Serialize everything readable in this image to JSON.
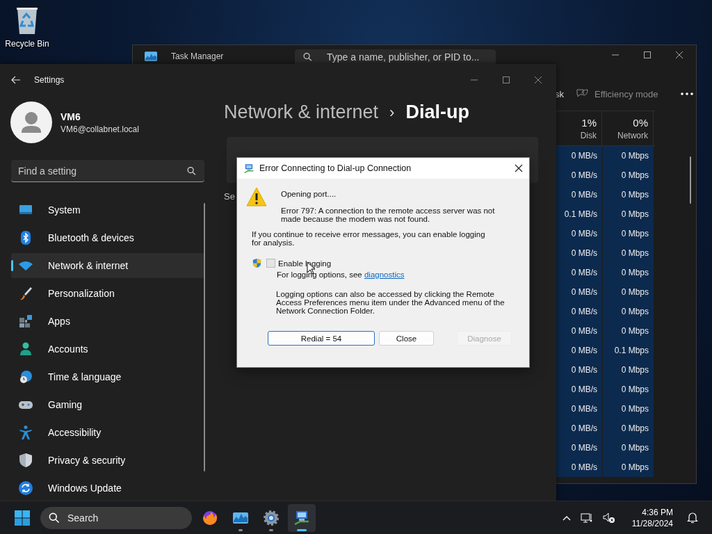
{
  "desktop_icons": [
    {
      "label": "Recycle Bin"
    }
  ],
  "task_manager": {
    "title": "Task Manager",
    "search": {
      "placeholder": "Type a name, publisher, or PID to..."
    },
    "toolbar": [
      {
        "label": "sk"
      },
      {
        "label": "Efficiency mode"
      }
    ],
    "columns": [
      {
        "percent": "1%",
        "label": "Disk"
      },
      {
        "percent": "0%",
        "label": "Network"
      }
    ],
    "rows": [
      {
        "disk": "0 MB/s",
        "network": "0 Mbps"
      },
      {
        "disk": "0 MB/s",
        "network": "0 Mbps"
      },
      {
        "disk": "0 MB/s",
        "network": "0 Mbps"
      },
      {
        "disk": "0.1 MB/s",
        "network": "0 Mbps"
      },
      {
        "disk": "0 MB/s",
        "network": "0 Mbps"
      },
      {
        "disk": "0 MB/s",
        "network": "0 Mbps"
      },
      {
        "disk": "0 MB/s",
        "network": "0 Mbps"
      },
      {
        "disk": "0 MB/s",
        "network": "0 Mbps"
      },
      {
        "disk": "0 MB/s",
        "network": "0 Mbps"
      },
      {
        "disk": "0 MB/s",
        "network": "0 Mbps"
      },
      {
        "disk": "0 MB/s",
        "network": "0.1 Mbps"
      },
      {
        "disk": "0 MB/s",
        "network": "0 Mbps"
      },
      {
        "disk": "0 MB/s",
        "network": "0 Mbps"
      },
      {
        "disk": "0 MB/s",
        "network": "0 Mbps"
      },
      {
        "disk": "0 MB/s",
        "network": "0 Mbps"
      },
      {
        "disk": "0 MB/s",
        "network": "0 Mbps"
      },
      {
        "disk": "0 MB/s",
        "network": "0 Mbps"
      }
    ]
  },
  "settings": {
    "title": "Settings",
    "user": {
      "name": "VM6",
      "email": "VM6@collabnet.local"
    },
    "search": {
      "placeholder": "Find a setting"
    },
    "nav": [
      {
        "label": "System",
        "selected": false
      },
      {
        "label": "Bluetooth & devices",
        "selected": false
      },
      {
        "label": "Network & internet",
        "selected": true
      },
      {
        "label": "Personalization",
        "selected": false
      },
      {
        "label": "Apps",
        "selected": false
      },
      {
        "label": "Accounts",
        "selected": false
      },
      {
        "label": "Time & language",
        "selected": false
      },
      {
        "label": "Gaming",
        "selected": false
      },
      {
        "label": "Accessibility",
        "selected": false
      },
      {
        "label": "Privacy & security",
        "selected": false
      },
      {
        "label": "Windows Update",
        "selected": false
      }
    ],
    "breadcrumb": {
      "parent": "Network & internet",
      "separator": "›",
      "current": "Dial-up"
    },
    "partial_text": "Se"
  },
  "dialog": {
    "title": "Error Connecting to Dial-up Connection",
    "status": "Opening port....",
    "error": "Error 797: A connection to the remote access server was not made because the modem was not found.",
    "info": "If you continue to receive error messages, you can enable logging for analysis.",
    "checkbox": {
      "label": "Enable logging",
      "checked": false
    },
    "hint": "For logging options, see ",
    "link": "diagnostics",
    "note": "Logging options can also be accessed by clicking the Remote Access Preferences menu item under the Advanced menu of the Network Connection Folder.",
    "buttons": [
      {
        "label": "Redial = 54",
        "default": true,
        "disabled": false
      },
      {
        "label": "Close",
        "default": false,
        "disabled": false
      },
      {
        "label": "Diagnose",
        "default": false,
        "disabled": true
      }
    ]
  },
  "taskbar": {
    "search": {
      "placeholder": "Search"
    },
    "apps": [
      {
        "kind": "browser",
        "running": false,
        "active": false
      },
      {
        "kind": "task-manager",
        "running": true,
        "active": false
      },
      {
        "kind": "settings",
        "running": true,
        "active": false
      },
      {
        "kind": "dialup",
        "running": true,
        "active": true
      }
    ],
    "time": "4:36 PM",
    "date": "11/28/2024"
  }
}
